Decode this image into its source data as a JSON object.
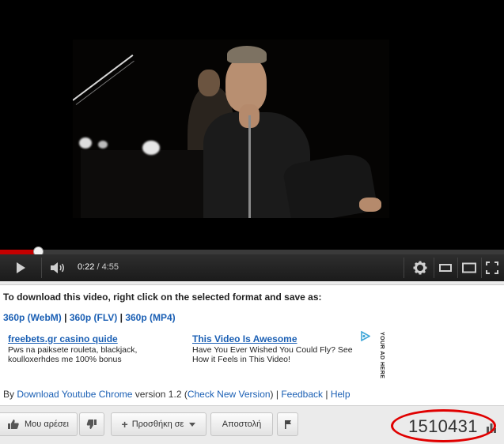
{
  "player": {
    "current_time": "0:22",
    "separator": " / ",
    "duration": "4:55",
    "progress_fraction": 0.0746
  },
  "download_panel": {
    "title": "To download this video, right click on the selected format and save as:",
    "formats": [
      "360p (WebM)",
      "360p (FLV)",
      "360p (MP4)"
    ],
    "format_separator": " | ",
    "ads": [
      {
        "title": "freebets.gr casino quide",
        "text_line1": "Pws na paiksete rouleta, blackjack,",
        "text_line2": "koulloxerhdes me 100% bonus"
      },
      {
        "title": "This Video Is Awesome",
        "text_line1": "Have You Ever Wished You Could Fly? See",
        "text_line2": "How it Feels in This Video!"
      }
    ],
    "ad_placeholder": "YOUR AD HERE",
    "footer": {
      "by": "By ",
      "product": "Download Youtube Chrome",
      "version": " version 1.2 (",
      "check": "Check New Version",
      "close_paren": ") | ",
      "feedback": "Feedback",
      "sep": " | ",
      "help": "Help"
    }
  },
  "actions": {
    "like_label": "Μου αρέσει",
    "add_label": "Προσθήκη σε",
    "share_label": "Αποστολή",
    "view_count": "1510431"
  },
  "colors": {
    "progress_played": "#c40000",
    "link": "#1a5fb4",
    "highlight_ellipse": "#e00000"
  },
  "icons": [
    "play-icon",
    "volume-icon",
    "gear-icon",
    "small-player-icon",
    "large-player-icon",
    "fullscreen-icon",
    "thumbs-up-icon",
    "thumbs-down-icon",
    "plus-icon",
    "chevron-down-icon",
    "flag-icon",
    "stats-icon",
    "adchoices-icon"
  ]
}
